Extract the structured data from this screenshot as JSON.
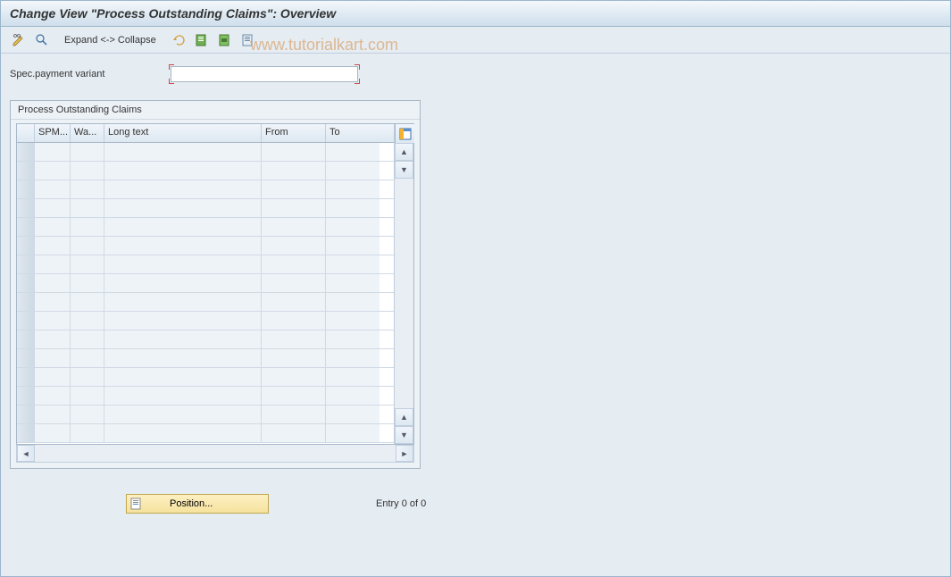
{
  "title": "Change View \"Process Outstanding Claims\": Overview",
  "toolbar": {
    "expand": "Expand <-> Collapse"
  },
  "watermark": "www.tutorialkart.com",
  "fields": {
    "spec_payment_variant_label": "Spec.payment variant",
    "spec_payment_variant_value": ""
  },
  "table": {
    "title": "Process Outstanding Claims",
    "columns": {
      "spm": "SPM...",
      "wa": "Wa...",
      "long_text": "Long text",
      "from": "From",
      "to": "To"
    },
    "rows": [
      {
        "spm": "",
        "wa": "",
        "long_text": "",
        "from": "",
        "to": ""
      },
      {
        "spm": "",
        "wa": "",
        "long_text": "",
        "from": "",
        "to": ""
      },
      {
        "spm": "",
        "wa": "",
        "long_text": "",
        "from": "",
        "to": ""
      },
      {
        "spm": "",
        "wa": "",
        "long_text": "",
        "from": "",
        "to": ""
      },
      {
        "spm": "",
        "wa": "",
        "long_text": "",
        "from": "",
        "to": ""
      },
      {
        "spm": "",
        "wa": "",
        "long_text": "",
        "from": "",
        "to": ""
      },
      {
        "spm": "",
        "wa": "",
        "long_text": "",
        "from": "",
        "to": ""
      },
      {
        "spm": "",
        "wa": "",
        "long_text": "",
        "from": "",
        "to": ""
      },
      {
        "spm": "",
        "wa": "",
        "long_text": "",
        "from": "",
        "to": ""
      },
      {
        "spm": "",
        "wa": "",
        "long_text": "",
        "from": "",
        "to": ""
      },
      {
        "spm": "",
        "wa": "",
        "long_text": "",
        "from": "",
        "to": ""
      },
      {
        "spm": "",
        "wa": "",
        "long_text": "",
        "from": "",
        "to": ""
      },
      {
        "spm": "",
        "wa": "",
        "long_text": "",
        "from": "",
        "to": ""
      },
      {
        "spm": "",
        "wa": "",
        "long_text": "",
        "from": "",
        "to": ""
      },
      {
        "spm": "",
        "wa": "",
        "long_text": "",
        "from": "",
        "to": ""
      },
      {
        "spm": "",
        "wa": "",
        "long_text": "",
        "from": "",
        "to": ""
      }
    ]
  },
  "footer": {
    "position_label": "Position...",
    "entry_text": "Entry 0 of 0"
  }
}
